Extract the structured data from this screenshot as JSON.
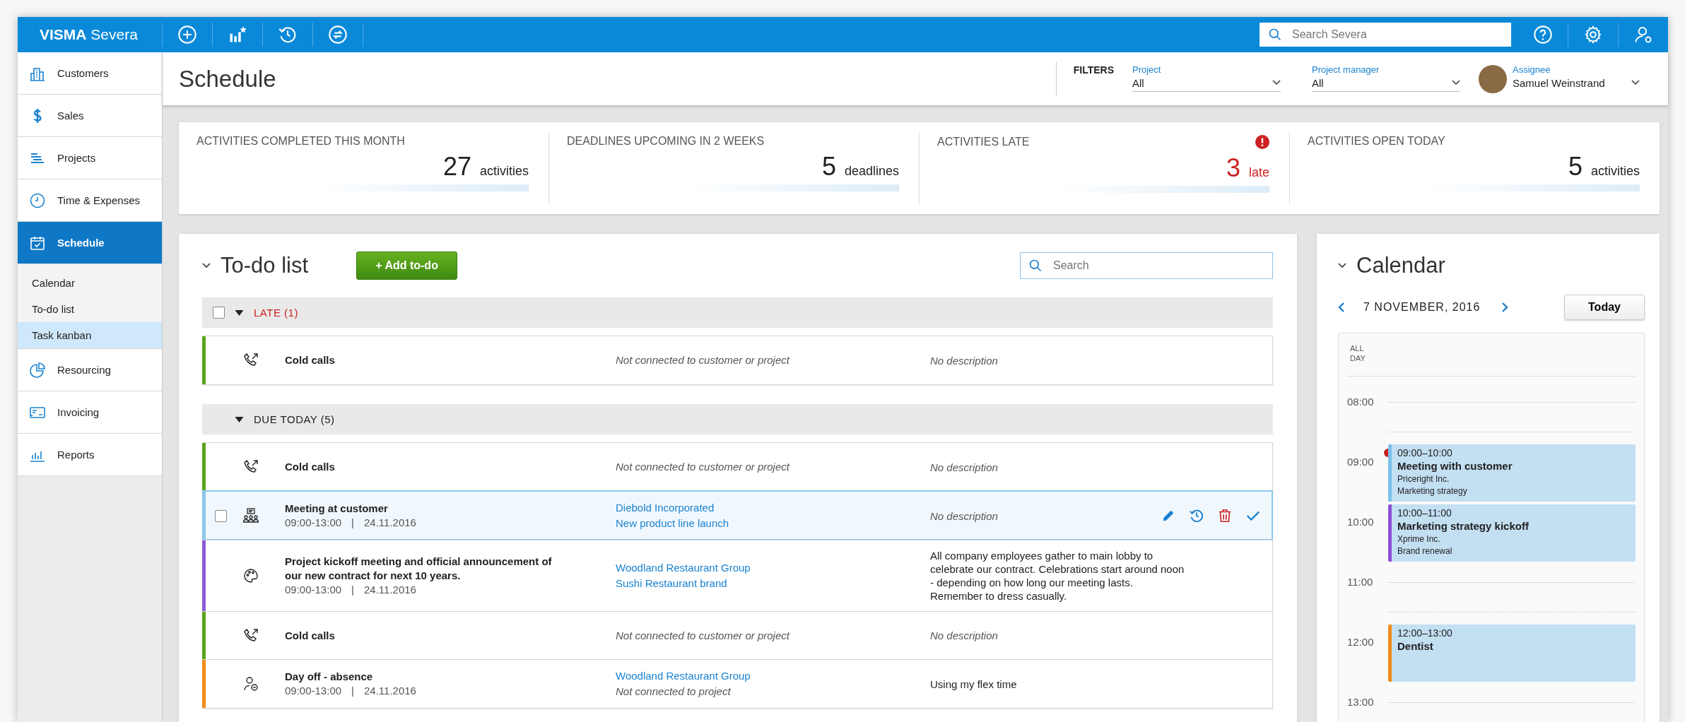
{
  "top_bar": {
    "logo_bold": "VISMA",
    "logo_light": "Severa",
    "search_placeholder": "Search Severa"
  },
  "sidebar": {
    "items": [
      {
        "label": "Customers",
        "selected": false
      },
      {
        "label": "Sales",
        "selected": false
      },
      {
        "label": "Projects",
        "selected": false
      },
      {
        "label": "Time & Expenses",
        "selected": false
      },
      {
        "label": "Schedule",
        "selected": true,
        "children": [
          {
            "label": "Calendar",
            "selected": false
          },
          {
            "label": "To-do list",
            "selected": false
          },
          {
            "label": "Task kanban",
            "selected": true
          }
        ]
      },
      {
        "label": "Resourcing",
        "selected": false
      },
      {
        "label": "Invoicing",
        "selected": false
      },
      {
        "label": "Reports",
        "selected": false
      }
    ]
  },
  "header": {
    "title": "Schedule",
    "filters_label": "FILTERS",
    "filters": [
      {
        "label": "Project",
        "value": "All"
      },
      {
        "label": "Project manager",
        "value": "All"
      }
    ],
    "assignee": {
      "label": "Assignee",
      "value": "Samuel Weinstrand"
    }
  },
  "kpis": [
    {
      "title": "ACTIVITIES COMPLETED THIS MONTH",
      "number": "27",
      "unit": "activities",
      "alert": false
    },
    {
      "title": "DEADLINES UPCOMING IN 2 WEEKS",
      "number": "5",
      "unit": "deadlines",
      "alert": false
    },
    {
      "title": "ACTIVITIES LATE",
      "number": "3",
      "unit": "late",
      "alert": true
    },
    {
      "title": "ACTIVITIES OPEN TODAY",
      "number": "5",
      "unit": "activities",
      "alert": false
    }
  ],
  "todo": {
    "title": "To-do list",
    "add_button": "+ Add to-do",
    "search_placeholder": "Search",
    "groups": [
      {
        "title": "LATE (1)",
        "kind": "late",
        "checked": false,
        "rows": [
          {
            "kind": "call",
            "title": "Cold calls",
            "note": "Not connected to customer or project",
            "description": "No description",
            "description_muted": true,
            "color": "#5aa51c",
            "selected": false
          }
        ]
      },
      {
        "title": "DUE TODAY (5)",
        "kind": "due",
        "rows": [
          {
            "kind": "call",
            "title": "Cold calls",
            "note": "Not connected to customer or project",
            "description": "No description",
            "description_muted": true,
            "color": "#5aa51c",
            "selected": false
          },
          {
            "kind": "meeting",
            "title": "Meeting at customer",
            "time": "09:00-13:00",
            "separator": "|",
            "date": "24.11.2016",
            "links": [
              "Diebold Incorporated",
              "New product line launch"
            ],
            "description": "No description",
            "description_muted": true,
            "color": "#8cc7ec",
            "selected": true
          },
          {
            "kind": "palette",
            "title": "Project kickoff meeting and official announcement of our new contract for next 10 years.",
            "time": "09:00-13:00",
            "separator": "|",
            "date": "24.11.2016",
            "links": [
              "Woodland Restaurant Group",
              "Sushi Restaurant brand"
            ],
            "description": "All company employees gather to main lobby to celebrate our contract. Celebrations start around noon - depending on how long our meeting lasts. Remember to dress casually.",
            "description_muted": false,
            "color": "#8c5ad6",
            "selected": false
          },
          {
            "kind": "call",
            "title": "Cold calls",
            "note": "Not connected to customer or project",
            "description": "No description",
            "description_muted": true,
            "color": "#5aa51c",
            "selected": false
          },
          {
            "kind": "absence",
            "title": "Day off - absence",
            "time": "09:00-13:00",
            "separator": "|",
            "date": "24.11.2016",
            "links": [
              "Woodland Restaurant Group"
            ],
            "note": "Not connected to project",
            "description": "Using my flex time",
            "description_muted": false,
            "color": "#f28c1a",
            "selected": false
          }
        ]
      }
    ]
  },
  "calendar": {
    "title": "Calendar",
    "date": "7 NOVEMBER, 2016",
    "today_button": "Today",
    "all_day_label": "ALL DAY",
    "hours": [
      "08:00",
      "09:00",
      "10:00",
      "11:00",
      "12:00",
      "13:00"
    ],
    "events": [
      {
        "time": "09:00–10:00",
        "title": "Meeting with customer",
        "lines": [
          "Priceright Inc.",
          "Marketing strategy"
        ],
        "color": "#7cc0ea"
      },
      {
        "time": "10:00–11:00",
        "title": "Marketing strategy kickoff",
        "lines": [
          "Xprime Inc.",
          "Brand renewal"
        ],
        "color": "#8c4fd6"
      },
      {
        "time": "12:00–13:00",
        "title": "Dentist",
        "color": "#f28c1a"
      }
    ]
  }
}
